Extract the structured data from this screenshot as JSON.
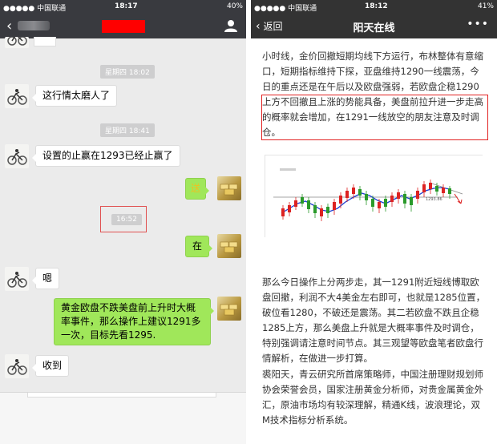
{
  "left": {
    "status": {
      "carrier": "●●●●● 中国联通",
      "time": "18:17",
      "battery": "40%"
    },
    "nav": {
      "back": "‹"
    },
    "messages": [
      {
        "type": "time",
        "text": "星期四 18:02"
      },
      {
        "type": "in",
        "text": "这行情太磨人了"
      },
      {
        "type": "time",
        "text": "星期四 18:41"
      },
      {
        "type": "in",
        "text": "设置的止赢在1293已经止赢了"
      },
      {
        "type": "out",
        "text": "送"
      },
      {
        "type": "time",
        "text": "16:52"
      },
      {
        "type": "out",
        "text": "在"
      },
      {
        "type": "in",
        "text": "嗯"
      },
      {
        "type": "out",
        "text": "黄金欧盘不跌美盘前上升时大概率事件，那么操作上建议1291多一次，目标先看1295."
      },
      {
        "type": "in",
        "text": "收到"
      }
    ],
    "colors": {
      "bar": "#393a3f",
      "bg": "#ebebeb",
      "green_bubble": "#a0e75a",
      "redact": "#ff0000"
    }
  },
  "right": {
    "status": {
      "carrier": "●●●●● 中国联通",
      "time": "18:12",
      "battery": "41%"
    },
    "nav": {
      "back": "返回",
      "title": "阳天在线",
      "more": "•••"
    },
    "para1": "小时线，金价回撤短期均线下方运行，布林整体有意缩口，短期指标维持下探，亚盘维持1290一线震荡，今日的重点还是在午后以及欧盘强弱，若欧盘企稳1290上方不回撤且上涨的势能具备，美盘前拉升进一步走高的概率就会增加，在1291一线放空的朋友注意及时调仓。",
    "chart_caption": "1293.86",
    "para2": "那么今日操作上分两步走，其一1291附近短线博取欧盘回撤，利润不大4美金左右即可，也就是1285位置，破位看1280，不破还是震荡。其二若欧盘不跌且企稳1285上方，那么美盘上升就是大概率事件及时调仓，特别强调请注意时间节点。其三观望等欧盘笔者欧盘行情解析，在做进一步打算。",
    "para3": "裘阳天，青云研究所首席策略师，中国注册理财规划师协会荣誉会员，国家注册黄金分析师，对贵金属黄金外汇，原油市场均有较深理解，精通K线，波浪理论，双M技术指标分析系统。",
    "colors": {
      "bar": "#333333",
      "highlight": "#e22222"
    }
  }
}
